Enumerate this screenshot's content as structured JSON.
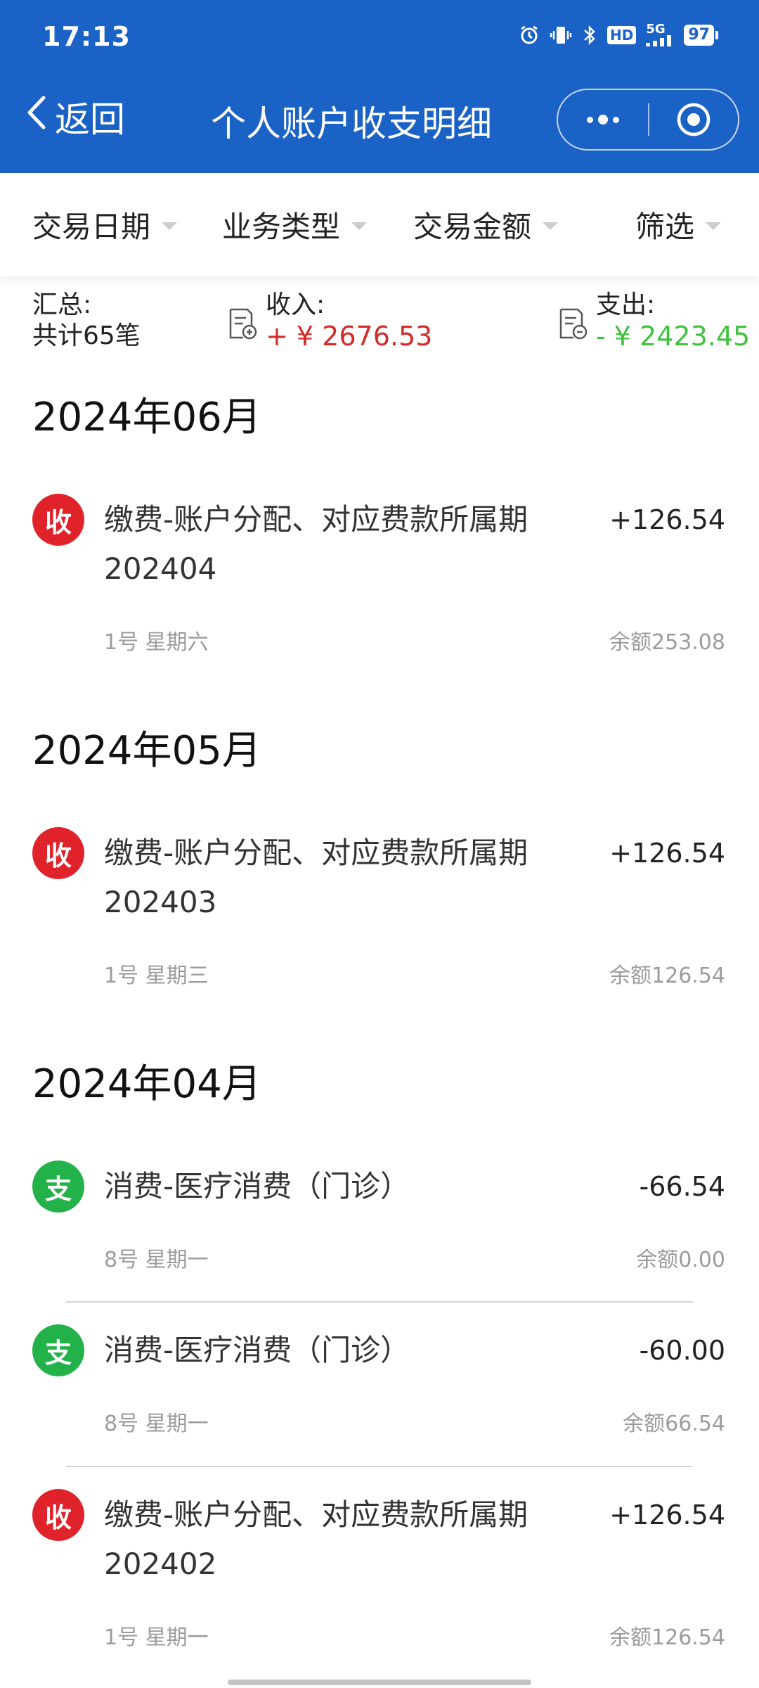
{
  "status_bar": {
    "time": "17:13",
    "network": "5G",
    "hd": "HD",
    "battery": "97"
  },
  "nav": {
    "back_label": "返回",
    "title": "个人账户收支明细"
  },
  "filters": {
    "date": "交易日期",
    "type": "业务类型",
    "amount": "交易金额",
    "filter": "筛选"
  },
  "summary": {
    "total_label": "汇总:",
    "total_count": "共计65笔",
    "income_label": "收入:",
    "income_amount": "+ ¥ 2676.53",
    "expense_label": "支出:",
    "expense_amount": "- ¥ 2423.45"
  },
  "months": [
    {
      "title": "2024年06月",
      "transactions": [
        {
          "badge": "收",
          "kind": "in",
          "desc_line1": "缴费-账户分配、对应费款所属期",
          "desc_line2": "202404",
          "amount": "+126.54",
          "date": "1号 星期六",
          "balance": "余额253.08"
        }
      ]
    },
    {
      "title": "2024年05月",
      "transactions": [
        {
          "badge": "收",
          "kind": "in",
          "desc_line1": "缴费-账户分配、对应费款所属期",
          "desc_line2": "202403",
          "amount": "+126.54",
          "date": "1号 星期三",
          "balance": "余额126.54"
        }
      ]
    },
    {
      "title": "2024年04月",
      "transactions": [
        {
          "badge": "支",
          "kind": "out",
          "desc_line1": "消费-医疗消费（门诊）",
          "amount": "-66.54",
          "date": "8号 星期一",
          "balance": "余额0.00"
        },
        {
          "badge": "支",
          "kind": "out",
          "desc_line1": "消费-医疗消费（门诊）",
          "amount": "-60.00",
          "date": "8号 星期一",
          "balance": "余额66.54"
        },
        {
          "badge": "收",
          "kind": "in",
          "desc_line1": "缴费-账户分配、对应费款所属期",
          "desc_line2": "202402",
          "amount": "+126.54",
          "date": "1号 星期一",
          "balance": "余额126.54"
        }
      ]
    }
  ],
  "colors": {
    "header_blue": "#1b62c6",
    "income_red": "#d42a2a",
    "expense_green": "#3fc23f",
    "badge_in": "#e0222a",
    "badge_out": "#23b24a"
  },
  "icons": [
    "alarm-icon",
    "vibrate-icon",
    "bluetooth-icon",
    "signal-icon",
    "battery-icon",
    "back-chevron-icon",
    "more-dots-icon",
    "close-target-icon",
    "income-doc-icon",
    "expense-doc-icon"
  ]
}
